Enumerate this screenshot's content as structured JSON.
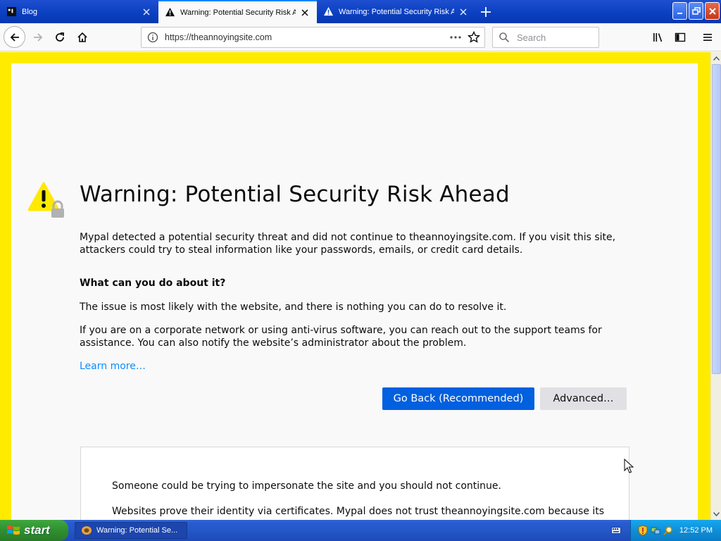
{
  "tabs": [
    {
      "title": "Blog",
      "active": false
    },
    {
      "title": "Warning: Potential Security Risk Ahead",
      "active": true
    },
    {
      "title": "Warning: Potential Security Risk Ahead",
      "active": false
    }
  ],
  "url": "https://theannoyingsite.com",
  "search": {
    "placeholder": "Search"
  },
  "page": {
    "title": "Warning: Potential Security Risk Ahead",
    "intro": "Mypal detected a potential security threat and did not continue to theannoyingsite.com. If you visit this site, attackers could try to steal information like your passwords, emails, or credit card details.",
    "subheading": "What can you do about it?",
    "para1": "The issue is most likely with the website, and there is nothing you can do to resolve it.",
    "para2": "If you are on a corporate network or using anti-virus software, you can reach out to the support teams for assistance. You can also notify the website’s administrator about the problem.",
    "learn_more": "Learn more…",
    "go_back_label": "Go Back (Recommended)",
    "advanced_label": "Advanced…",
    "advanced_para1": "Someone could be trying to impersonate the site and you should not continue.",
    "advanced_para2": "Websites prove their identity via certificates. Mypal does not trust theannoyingsite.com because its"
  },
  "taskbar": {
    "start_label": "start",
    "task_title": "Warning: Potential Se...",
    "clock": "12:52 PM"
  },
  "colors": {
    "page_border": "#ffeb00",
    "primary_button": "#0060df",
    "link": "#0a8dff",
    "warning_icon": "#ffe900"
  }
}
